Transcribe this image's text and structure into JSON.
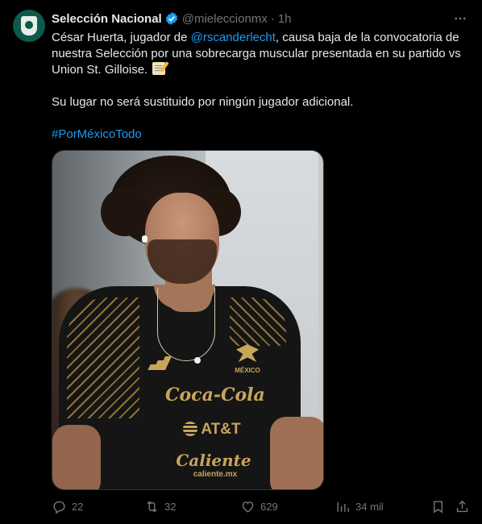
{
  "author": {
    "name": "Selección Nacional",
    "handle": "@mieleccionmx",
    "separator": "·",
    "time": "1h"
  },
  "tweet": {
    "line1_before": "César Huerta, jugador de ",
    "mention": "@rscanderlecht",
    "line1_after": ", causa baja de la convocatoria de nuestra Selección por una sobrecarga muscular presentada en su partido vs Union St. Gilloise.",
    "line2": "Su lugar no será sustituido por ningún jugador adicional.",
    "hashtag": "#PorMéxicoTodo"
  },
  "photo": {
    "sponsors": {
      "mexico": "MÉXICO",
      "coke": "Coca-Cola",
      "att": "AT&T",
      "caliente": "Caliente",
      "caliente_url": "caliente.mx"
    }
  },
  "actions": {
    "replies": "22",
    "retweets": "32",
    "likes": "629",
    "views": "34 mil"
  },
  "colors": {
    "background": "#000000",
    "text": "#e7e9ea",
    "secondary": "#71767b",
    "link": "#1d9bf0",
    "verified": "#1d9bf0",
    "avatar": "#0d5a4c"
  },
  "icons": [
    "more-icon",
    "verified-icon",
    "reply-icon",
    "retweet-icon",
    "like-icon",
    "views-icon",
    "bookmark-icon",
    "share-icon",
    "memo-emoji"
  ]
}
